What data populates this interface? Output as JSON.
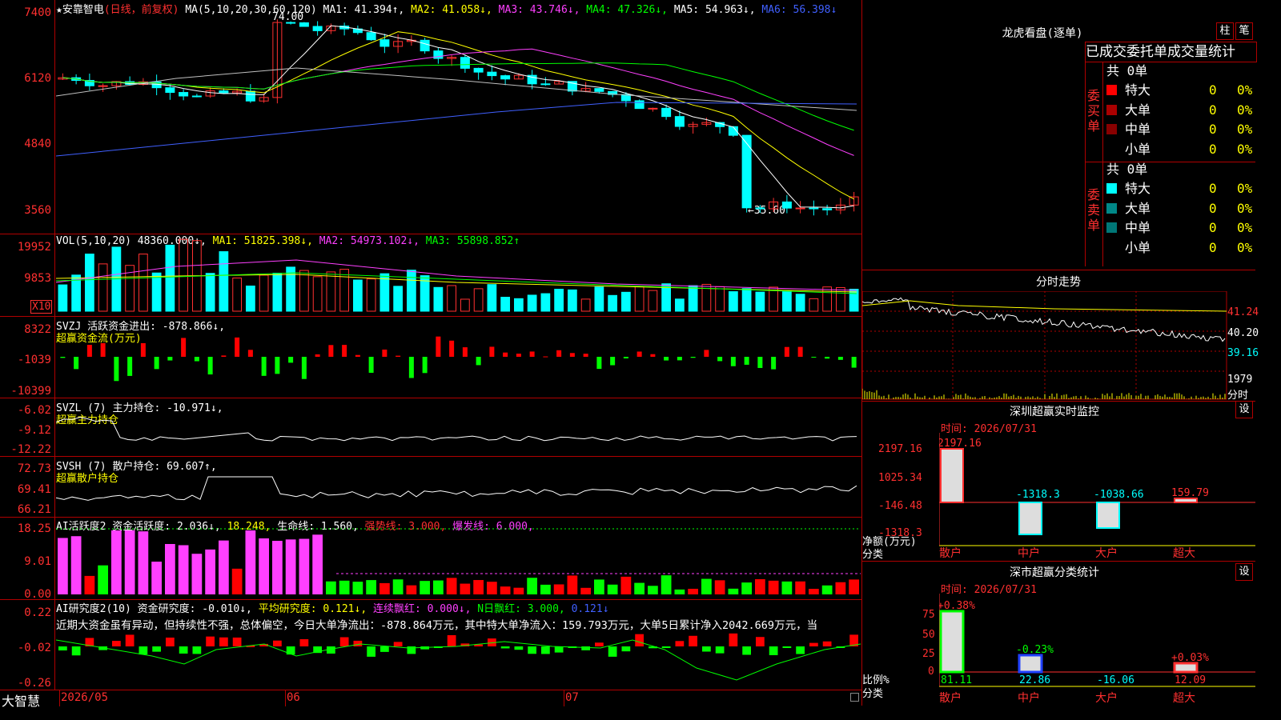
{
  "stock": {
    "name_prefix": "★安靠智电",
    "mode": "(日线，前复权)",
    "ma_params": "MA(5,10,20,30,60,120)",
    "ma": [
      {
        "label": "MA1: 41.394↑,",
        "color": "#ffffff"
      },
      {
        "label": "MA2: 41.058↓,",
        "color": "#ffff00"
      },
      {
        "label": "MA3: 43.746↓,",
        "color": "#ff40ff"
      },
      {
        "label": "MA4: 47.326↓,",
        "color": "#00ff00"
      },
      {
        "label": "MA5: 54.963↓,",
        "color": "#ffffff"
      },
      {
        "label": "MA6: 56.398↓",
        "color": "#4060ff"
      }
    ],
    "high_label": "74.00",
    "low_label": "←35.60",
    "y_labels": [
      "7400",
      "6120",
      "4840",
      "3560"
    ]
  },
  "vol": {
    "params": "VOL(5,10,20)",
    "value": "48360.000↓,",
    "ma1": "MA1: 51825.398↓,",
    "ma2": "MA2: 54973.102↓,",
    "ma3": "MA3: 55898.852↑",
    "y_labels": [
      "19952",
      "9853"
    ],
    "unit": "X10"
  },
  "svzj": {
    "line1": "SVZJ  活跃资金进出: -878.866↓,",
    "line2": "超赢资金流(万元)",
    "y_labels": [
      "8322",
      "-1039",
      "-10399"
    ]
  },
  "svzl": {
    "line1": "SVZL (7) 主力持仓: -10.971↓,",
    "line2": "超赢主力持仓",
    "y_labels": [
      "-6.02",
      "-9.12",
      "-12.22"
    ]
  },
  "svsh": {
    "line1": "SVSH (7) 散户持仓: 69.607↑,",
    "line2": "超赢散户持仓",
    "y_labels": [
      "72.73",
      "69.41",
      "66.21"
    ]
  },
  "ai1": {
    "t1": "AI活跃度2 资金活跃度: 2.036↓,",
    "t2": "18.248,",
    "t3": "生命线: 1.560,",
    "t4": "强势线: 3.000,",
    "t5": "爆发线: 6.000,",
    "y_labels": [
      "18.25",
      "9.01",
      "0.00"
    ]
  },
  "ai2": {
    "t1": "AI研究度2(10) 资金研究度: -0.010↓,",
    "t2": "平均研究度: 0.121↓,",
    "t3": "连续飘红: 0.000↓,",
    "t4": "N日飘红: 3.000,",
    "t5": "0.121↓",
    "text": "近期大资金虽有异动，但持续性不强，总体偏空，今日大单净流出：-878.864万元，其中特大单净流入：159.793万元，大单5日累计净入2042.669万元，当",
    "y_labels": [
      "0.22",
      "-0.02",
      "-0.26"
    ]
  },
  "dates": [
    "2026/05",
    "06",
    "07"
  ],
  "brand": "大智慧",
  "right": {
    "lhb_title": "龙虎看盘(逐单)",
    "btn1": "柱",
    "btn2": "笔",
    "tabs": "已成交委托单成交量统计",
    "buy_side": "委买单",
    "sell_side": "委卖单",
    "buy_total": "共 0单",
    "sell_total": "共 0单",
    "buy_rows": [
      {
        "label": "特大",
        "val": "0",
        "pct": "0%",
        "color": "#ff0000"
      },
      {
        "label": "大单",
        "val": "0",
        "pct": "0%",
        "color": "#aa0000"
      },
      {
        "label": "中单",
        "val": "0",
        "pct": "0%",
        "color": "#880000"
      },
      {
        "label": "小单",
        "val": "0",
        "pct": "0%",
        "color": "#000000"
      }
    ],
    "sell_rows": [
      {
        "label": "特大",
        "val": "0",
        "pct": "0%",
        "color": "#00ffff"
      },
      {
        "label": "大单",
        "val": "0",
        "pct": "0%",
        "color": "#008888"
      },
      {
        "label": "中单",
        "val": "0",
        "pct": "0%",
        "color": "#007777"
      },
      {
        "label": "小单",
        "val": "0",
        "pct": "0%",
        "color": "#000000"
      }
    ],
    "fs_title": "分时走势",
    "fs_labels": [
      "41.24",
      "40.20",
      "39.16"
    ],
    "fs_vol": "1979",
    "fs_unit": "分时",
    "mon_title": "深圳超赢实时监控",
    "mon_btn": "设",
    "mon_time": "时间: 2026/07/31",
    "mon_y": [
      "2197.16",
      "1025.34",
      "-146.48",
      "-1318.3"
    ],
    "mon_ylabel1": "净额(万元)",
    "mon_ylabel2": "分类",
    "mon_bars": [
      {
        "cat": "散户",
        "val": "2197.16",
        "color": "#ff3030"
      },
      {
        "cat": "中户",
        "val": "-1318.3",
        "color": "#00ffff"
      },
      {
        "cat": "大户",
        "val": "-1038.66",
        "color": "#00ffff"
      },
      {
        "cat": "超大",
        "val": "159.79",
        "color": "#ff3030"
      }
    ],
    "cls_title": "深市超赢分类统计",
    "cls_btn": "设",
    "cls_time": "时间: 2026/07/31",
    "cls_y": [
      "75",
      "50",
      "25",
      "0"
    ],
    "cls_ylabel1": "比例%",
    "cls_ylabel2": "分类",
    "cls_bars": [
      {
        "cat": "散户",
        "pct": "+0.38%",
        "val": "81.11"
      },
      {
        "cat": "中户",
        "pct": "-0.23%",
        "val": "22.86"
      },
      {
        "cat": "大户",
        "pct": "",
        "val": "-16.06"
      },
      {
        "cat": "超大",
        "pct": "+0.03%",
        "val": "12.09"
      }
    ]
  }
}
